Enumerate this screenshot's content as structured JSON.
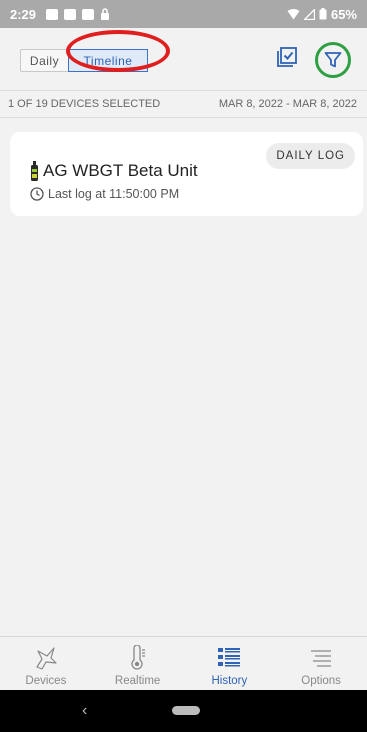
{
  "status_bar": {
    "time": "2:29",
    "battery": "65%"
  },
  "toolbar": {
    "tabs": [
      {
        "label": "Daily",
        "selected": false
      },
      {
        "label": "Timeline",
        "selected": true
      }
    ],
    "icons": [
      "check-list-icon",
      "filter-icon"
    ],
    "annotation_colors": {
      "timeline_circle": "#e01e1e",
      "filter_circle": "#2ea043"
    }
  },
  "info": {
    "selection": "1 OF 19 DEVICES SELECTED",
    "date_range": "MAR 8, 2022 - MAR 8, 2022"
  },
  "device_card": {
    "name": "AG WBGT Beta Unit",
    "last_log": "Last log at 11:50:00 PM",
    "daily_log_button": "DAILY LOG"
  },
  "bottom_nav": {
    "items": [
      {
        "label": "Devices",
        "icon": "bird-icon",
        "active": false
      },
      {
        "label": "Realtime",
        "icon": "thermometer-icon",
        "active": false
      },
      {
        "label": "History",
        "icon": "list-icon",
        "active": true
      },
      {
        "label": "Options",
        "icon": "menu-lines-icon",
        "active": false
      }
    ]
  },
  "colors": {
    "accent": "#2f63b5",
    "status_bar": "#a9a9a9",
    "background": "#f2f2f2"
  }
}
